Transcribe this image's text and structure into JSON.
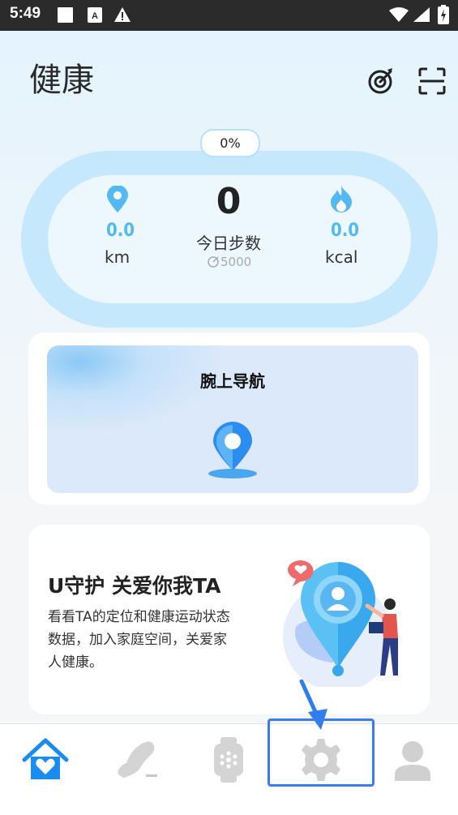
{
  "status_bar": {
    "time": "5:49"
  },
  "header": {
    "title": "健康"
  },
  "progress": {
    "percent_label": "0%",
    "value": 0
  },
  "stats": {
    "distance": {
      "value": "0.0",
      "unit": "km"
    },
    "steps": {
      "value": "0",
      "label": "今日步数",
      "goal": "5000"
    },
    "calories": {
      "value": "0.0",
      "unit": "kcal"
    }
  },
  "nav_card": {
    "title": "腕上导航"
  },
  "guard_card": {
    "title": "U守护 关爱你我TA",
    "desc_line1": "看看TA的定位和健康运动状态",
    "desc_line2": "数据，加入家庭空间，关爱家",
    "desc_line3": "人健康。"
  },
  "tabs": [
    {
      "name": "home",
      "icon": "home-heart-icon",
      "active": true
    },
    {
      "name": "sport",
      "icon": "shoe-icon",
      "active": false
    },
    {
      "name": "device",
      "icon": "watch-icon",
      "active": false
    },
    {
      "name": "settings",
      "icon": "gear-icon",
      "active": false
    },
    {
      "name": "profile",
      "icon": "user-icon",
      "active": false
    }
  ],
  "colors": {
    "accent": "#1a8cf0",
    "stat_blue": "#54b8f2",
    "highlight": "#3a7cf0"
  }
}
